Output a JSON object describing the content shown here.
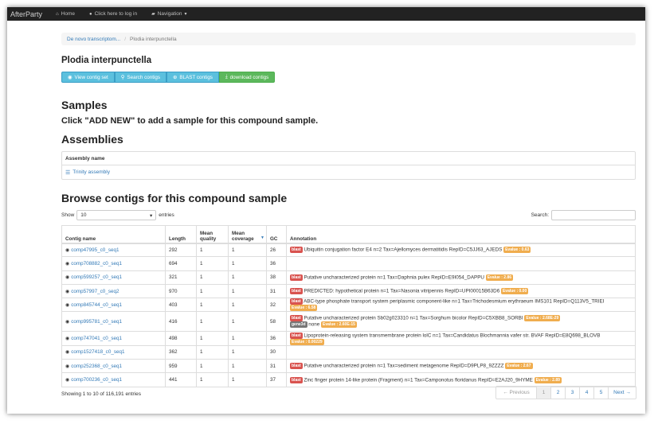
{
  "navbar": {
    "brand": "AfterParty",
    "home_label": "Home",
    "login_label": "Click here to log in",
    "navigation_label": "Navigation"
  },
  "breadcrumb": {
    "parent": "De novo transcriptom...",
    "current": "Plodia interpunctella"
  },
  "species_title": "Plodia interpunctella",
  "actions": {
    "view": "View contig set",
    "search": "Search contigs",
    "blast": "BLAST contigs",
    "download": "download contigs"
  },
  "samples": {
    "heading": "Samples",
    "message": "Click \"ADD NEW\" to add a sample for this compound sample."
  },
  "assemblies": {
    "heading": "Assemblies",
    "column_header": "Assembly name",
    "item": "Trinity assembly"
  },
  "browse": {
    "heading": "Browse contigs for this compound sample",
    "show_label": "Show",
    "entries_label": "entries",
    "page_length": "10",
    "search_label": "Search:",
    "search_value": "",
    "columns": {
      "contig": "Contig name",
      "length": "Length",
      "mean_quality": "Mean quality",
      "mean_coverage": "Mean coverage",
      "gc": "GC",
      "annotation": "Annotation"
    },
    "rows": [
      {
        "contig": "comp47995_c0_seq1",
        "length": "292",
        "quality": "1",
        "coverage": "1",
        "gc": "26",
        "ann": [
          {
            "type": "blast",
            "text": "Ubiquitin conjugation factor E4 n=2 Tax=Ajellomyces dermatitidis RepID=C5JJ63_AJEDS",
            "ev": "Evalue : 0.63"
          }
        ]
      },
      {
        "contig": "comp708882_c0_seq1",
        "length": "694",
        "quality": "1",
        "coverage": "1",
        "gc": "36",
        "ann": []
      },
      {
        "contig": "comp599257_c0_seq1",
        "length": "321",
        "quality": "1",
        "coverage": "1",
        "gc": "38",
        "ann": [
          {
            "type": "blast",
            "text": "Putative uncharacterized protein n=1 Tax=Daphnia pulex RepID=E9I054_DAPPU",
            "ev": "Evalue : 2.86"
          }
        ]
      },
      {
        "contig": "comp57997_c0_seq2",
        "length": "970",
        "quality": "1",
        "coverage": "1",
        "gc": "31",
        "ann": [
          {
            "type": "blast",
            "text": "PREDICTED: hypothetical protein n=1 Tax=Nasonia vitripennis RepID=UPI00015B63D6",
            "ev": "Evalue : 0.00"
          }
        ]
      },
      {
        "contig": "comp845744_c0_seq1",
        "length": "403",
        "quality": "1",
        "coverage": "1",
        "gc": "32",
        "ann": [
          {
            "type": "blast",
            "text": "ABC-type phosphate transport system periplasmic component-like n=1 Tax=Trichodesmium erythraeum IMS101 RepID=Q113V5_TRIEI",
            "ev": "Evalue : 6.58"
          }
        ]
      },
      {
        "contig": "comp995781_c0_seq1",
        "length": "416",
        "quality": "1",
        "coverage": "1",
        "gc": "58",
        "ann": [
          {
            "type": "blast",
            "text": "Putative uncharacterized protein Sb02g023310 n=1 Tax=Sorghum bicolor RepID=C5XBB8_SORBI",
            "ev": "Evalue : 2.68E-29"
          },
          {
            "type": "gene3d",
            "text": "none",
            "ev": "Evalue : 2.60E-15"
          }
        ]
      },
      {
        "contig": "comp747041_c0_seq1",
        "length": "498",
        "quality": "1",
        "coverage": "1",
        "gc": "36",
        "ann": [
          {
            "type": "blast",
            "text": "Lipoprotein-releasing system transmembrane protein lolC n=1 Tax=Candidatus Blochmannia vafer str. BVAF RepID=E8Q698_BLOVB",
            "ev": "Evalue : 0.00229"
          }
        ]
      },
      {
        "contig": "comp1527418_c0_seq1",
        "length": "362",
        "quality": "1",
        "coverage": "1",
        "gc": "30",
        "ann": []
      },
      {
        "contig": "comp252368_c0_seq1",
        "length": "959",
        "quality": "1",
        "coverage": "1",
        "gc": "31",
        "ann": [
          {
            "type": "blast",
            "text": "Putative uncharacterized protein n=1 Tax=sediment metagenome RepID=D9PLP8_9ZZZZ",
            "ev": "Evalue : 2.67"
          }
        ]
      },
      {
        "contig": "comp700236_c0_seq1",
        "length": "441",
        "quality": "1",
        "coverage": "1",
        "gc": "37",
        "ann": [
          {
            "type": "blast",
            "text": "Zinc finger protein 14-like protein (Fragment) n=1 Tax=Camponotus floridanus RepID=E2AJ20_9HYME",
            "ev": "Evalue : 2.89"
          }
        ]
      }
    ],
    "info": "Showing 1 to 10 of 116,191 entries",
    "pagination": {
      "prev": "← Previous",
      "pages": [
        "1",
        "2",
        "3",
        "4",
        "5"
      ],
      "next": "Next →"
    }
  },
  "colors": {
    "navbar": "#222222",
    "link": "#337ab7",
    "btn_info": "#5bc0de",
    "btn_success": "#5cb85c",
    "label_blast": "#d9534f",
    "label_evalue": "#f0ad4e",
    "label_gene3d": "#777777"
  }
}
